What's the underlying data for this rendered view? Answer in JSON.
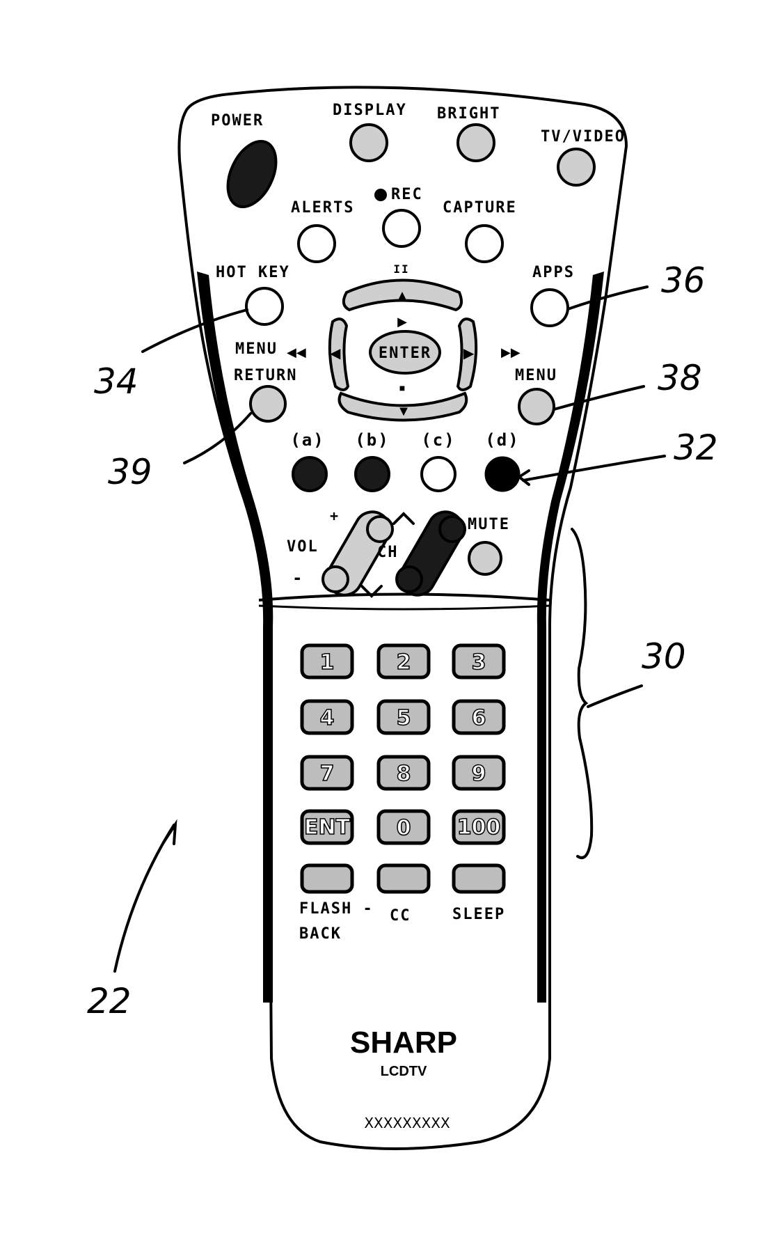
{
  "figure": {
    "type": "patent-drawing",
    "subject": "remote control",
    "brand": "SHARP",
    "product_line": "LCDTV",
    "model_placeholder": "XXXXXXXXX"
  },
  "top_buttons": {
    "power": "POWER",
    "display": "DISPLAY",
    "bright": "BRIGHT",
    "tv_video": "TV/VIDEO"
  },
  "second_row": {
    "alerts": "ALERTS",
    "rec": "REC",
    "capture": "CAPTURE"
  },
  "side_buttons": {
    "hot_key": "HOT KEY",
    "apps": "APPS",
    "menu_return_line1": "MENU",
    "menu_return_line2": "RETURN",
    "menu": "MENU"
  },
  "nav": {
    "enter": "ENTER",
    "pause_symbol": "II",
    "play_symbol": "▶",
    "stop_symbol": "■",
    "rewind_symbol": "◀◀",
    "ffwd_symbol": "▶▶",
    "up_symbol": "▲",
    "down_symbol": "▼",
    "left_symbol": "◀",
    "right_symbol": "▶"
  },
  "color_buttons": [
    {
      "label": "(a)",
      "fill": "dark"
    },
    {
      "label": "(b)",
      "fill": "dark"
    },
    {
      "label": "(c)",
      "fill": "white"
    },
    {
      "label": "(d)",
      "fill": "black"
    }
  ],
  "vol_ch": {
    "vol": "VOL",
    "ch": "CH",
    "mute": "MUTE",
    "plus": "+",
    "minus": "-",
    "up": "^",
    "down": "v"
  },
  "keypad": {
    "rows": [
      [
        "1",
        "2",
        "3"
      ],
      [
        "4",
        "5",
        "6"
      ],
      [
        "7",
        "8",
        "9"
      ],
      [
        "ENT",
        "0",
        "100"
      ]
    ],
    "bottom": [
      {
        "label_line1": "FLASH -",
        "label_line2": "BACK"
      },
      {
        "label_line1": "CC",
        "label_line2": ""
      },
      {
        "label_line1": "SLEEP",
        "label_line2": ""
      }
    ]
  },
  "reference_numerals": {
    "hot_key": "34",
    "apps": "36",
    "menu": "38",
    "menu_return": "39",
    "color_buttons": "32",
    "lower_section": "30",
    "remote": "22"
  }
}
